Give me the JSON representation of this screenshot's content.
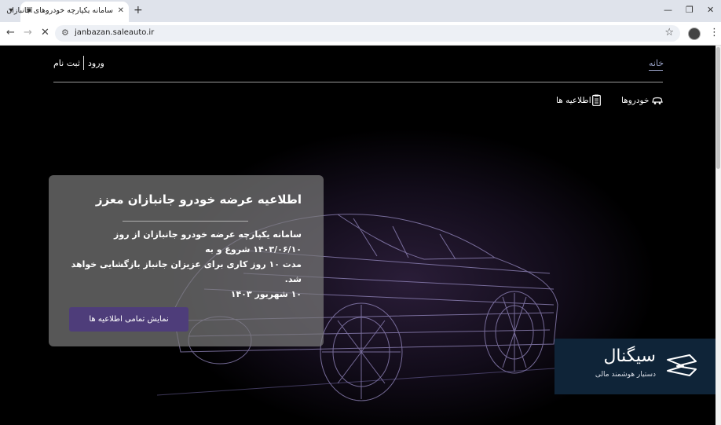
{
  "browser": {
    "tab_title": "سامانه یکپارچه خودروهای جانبازان",
    "url": "janbazan.saleauto.ir",
    "new_tab": "+",
    "controls": {
      "minimize": "—",
      "maximize": "❐",
      "close": "✕"
    }
  },
  "header": {
    "login": "ورود",
    "register": "ثبت نام",
    "home": "خانه"
  },
  "nav": {
    "cars": "خودروها",
    "notices": "اطلاعیه ها"
  },
  "card": {
    "title": "اطلاعیه عرضه خودرو جانبازان معزز",
    "line1": "سامانه یکپارچه عرضه خودرو جانبازان از روز ۱۴۰۳/۰۶/۱۰ شروع و به",
    "line2": "مدت ۱۰ روز کاری برای عزیزان جانباز بازگشایی خواهد شد.",
    "line3": "۱۰ شهریور ۱۴۰۳",
    "button": "نمایش تمامی اطلاعیه ها"
  },
  "watermark": {
    "name": "سیگنال",
    "tagline": "دستیار هوشمند مالی"
  },
  "colors": {
    "button": "#4e3d7a",
    "home_link": "#9aa3c8",
    "watermark_bg": "#0f2438"
  }
}
